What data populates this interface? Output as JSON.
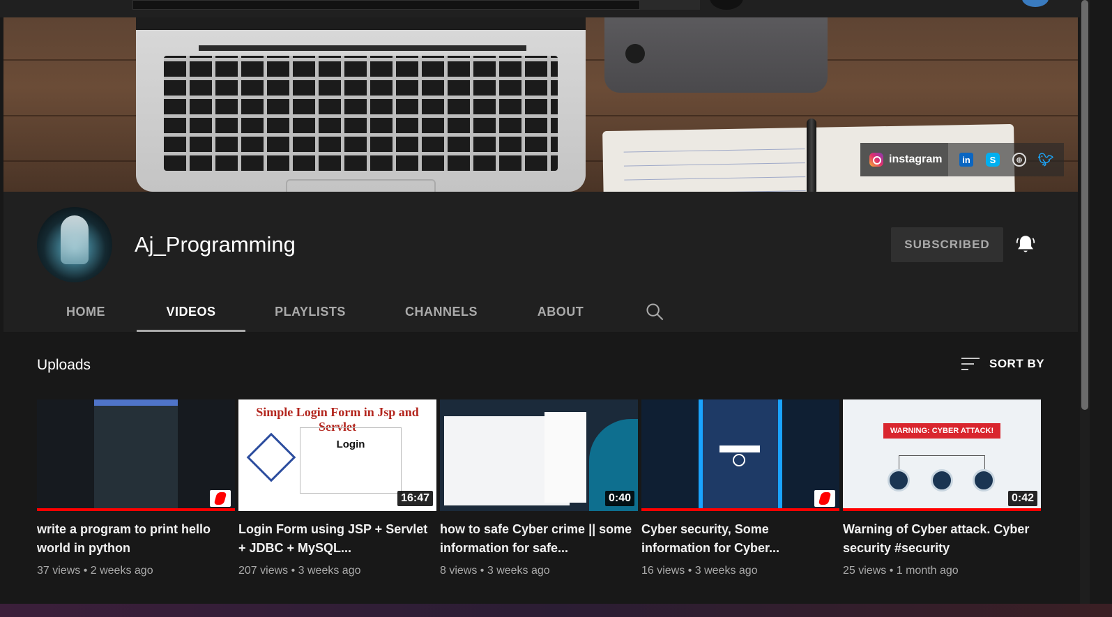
{
  "banner": {
    "links": {
      "instagram_label": "instagram",
      "icons": [
        "linkedin-icon",
        "skype-icon",
        "globe-icon",
        "twitter-icon"
      ]
    }
  },
  "channel": {
    "name": "Aj_Programming",
    "subscribe_label": "SUBSCRIBED"
  },
  "tabs": [
    {
      "label": "HOME",
      "active": false
    },
    {
      "label": "VIDEOS",
      "active": true
    },
    {
      "label": "PLAYLISTS",
      "active": false
    },
    {
      "label": "CHANNELS",
      "active": false
    },
    {
      "label": "ABOUT",
      "active": false
    }
  ],
  "uploads": {
    "title": "Uploads",
    "sort_label": "SORT BY",
    "videos": [
      {
        "title": "write a program to print hello world in python",
        "views": "37 views",
        "age": "2 weeks ago",
        "duration": "",
        "short": true,
        "watched_fraction": 1.0
      },
      {
        "title": "Login Form using JSP + Servlet + JDBC + MySQL...",
        "views": "207 views",
        "age": "3 weeks ago",
        "duration": "16:47",
        "short": false,
        "watched_fraction": 0,
        "thumb_text": "Simple Login Form in Jsp and Servlet",
        "thumb_form_title": "Login"
      },
      {
        "title": "how to safe Cyber crime || some information for safe...",
        "views": "8 views",
        "age": "3 weeks ago",
        "duration": "0:40",
        "short": false,
        "watched_fraction": 0
      },
      {
        "title": "Cyber security, Some information for Cyber...",
        "views": "16 views",
        "age": "3 weeks ago",
        "duration": "",
        "short": true,
        "watched_fraction": 1.0
      },
      {
        "title": "Warning of Cyber attack. Cyber security #security",
        "views": "25 views",
        "age": "1 month ago",
        "duration": "0:42",
        "short": false,
        "watched_fraction": 1.0,
        "thumb_text": "WARNING: CYBER ATTACK!"
      }
    ]
  },
  "colors": {
    "background": "#181818",
    "header": "#202020",
    "progress": "#ff0000",
    "subscribed_bg": "#303030"
  }
}
